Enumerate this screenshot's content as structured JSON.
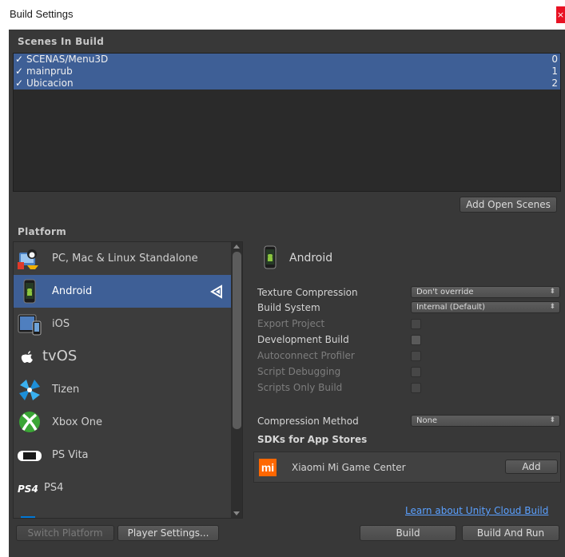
{
  "window": {
    "title": "Build Settings",
    "close": "×"
  },
  "scenes": {
    "header": "Scenes In Build",
    "items": [
      {
        "name": "SCENAS/Menu3D",
        "index": "0",
        "checked": "✓"
      },
      {
        "name": "mainprub",
        "index": "1",
        "checked": "✓"
      },
      {
        "name": "Ubicacion",
        "index": "2",
        "checked": "✓"
      }
    ],
    "add_open_scenes": "Add Open Scenes"
  },
  "platform": {
    "header": "Platform",
    "items": [
      {
        "label": "PC, Mac & Linux Standalone",
        "icon": "pc-standalone-icon"
      },
      {
        "label": "Android",
        "icon": "android-icon",
        "selected": true
      },
      {
        "label": "iOS",
        "icon": "ios-icon"
      },
      {
        "label": "tvOS",
        "icon": "appletv-icon"
      },
      {
        "label": "Tizen",
        "icon": "tizen-icon"
      },
      {
        "label": "Xbox One",
        "icon": "xbox-icon"
      },
      {
        "label": "PS Vita",
        "icon": "psvita-icon"
      },
      {
        "label": "PS4",
        "icon": "ps4-icon"
      }
    ]
  },
  "settings": {
    "title": "Android",
    "texture_compression_label": "Texture Compression",
    "texture_compression_value": "Don't override",
    "build_system_label": "Build System",
    "build_system_value": "Internal (Default)",
    "export_project": "Export Project",
    "development_build": "Development Build",
    "autoconnect_profiler": "Autoconnect Profiler",
    "script_debugging": "Script Debugging",
    "scripts_only_build": "Scripts Only Build",
    "compression_method_label": "Compression Method",
    "compression_method_value": "None",
    "sdks_header": "SDKs for App Stores",
    "store_name": "Xiaomi Mi Game Center",
    "store_logo": "mi",
    "add_button": "Add"
  },
  "footer": {
    "cloud_link": "Learn about Unity Cloud Build",
    "switch_platform": "Switch Platform",
    "player_settings": "Player Settings...",
    "build": "Build",
    "build_and_run": "Build And Run"
  },
  "colors": {
    "selection": "#3e5f96",
    "background": "#383838",
    "link": "#5aa0ff",
    "xiaomi": "#ff6700"
  }
}
